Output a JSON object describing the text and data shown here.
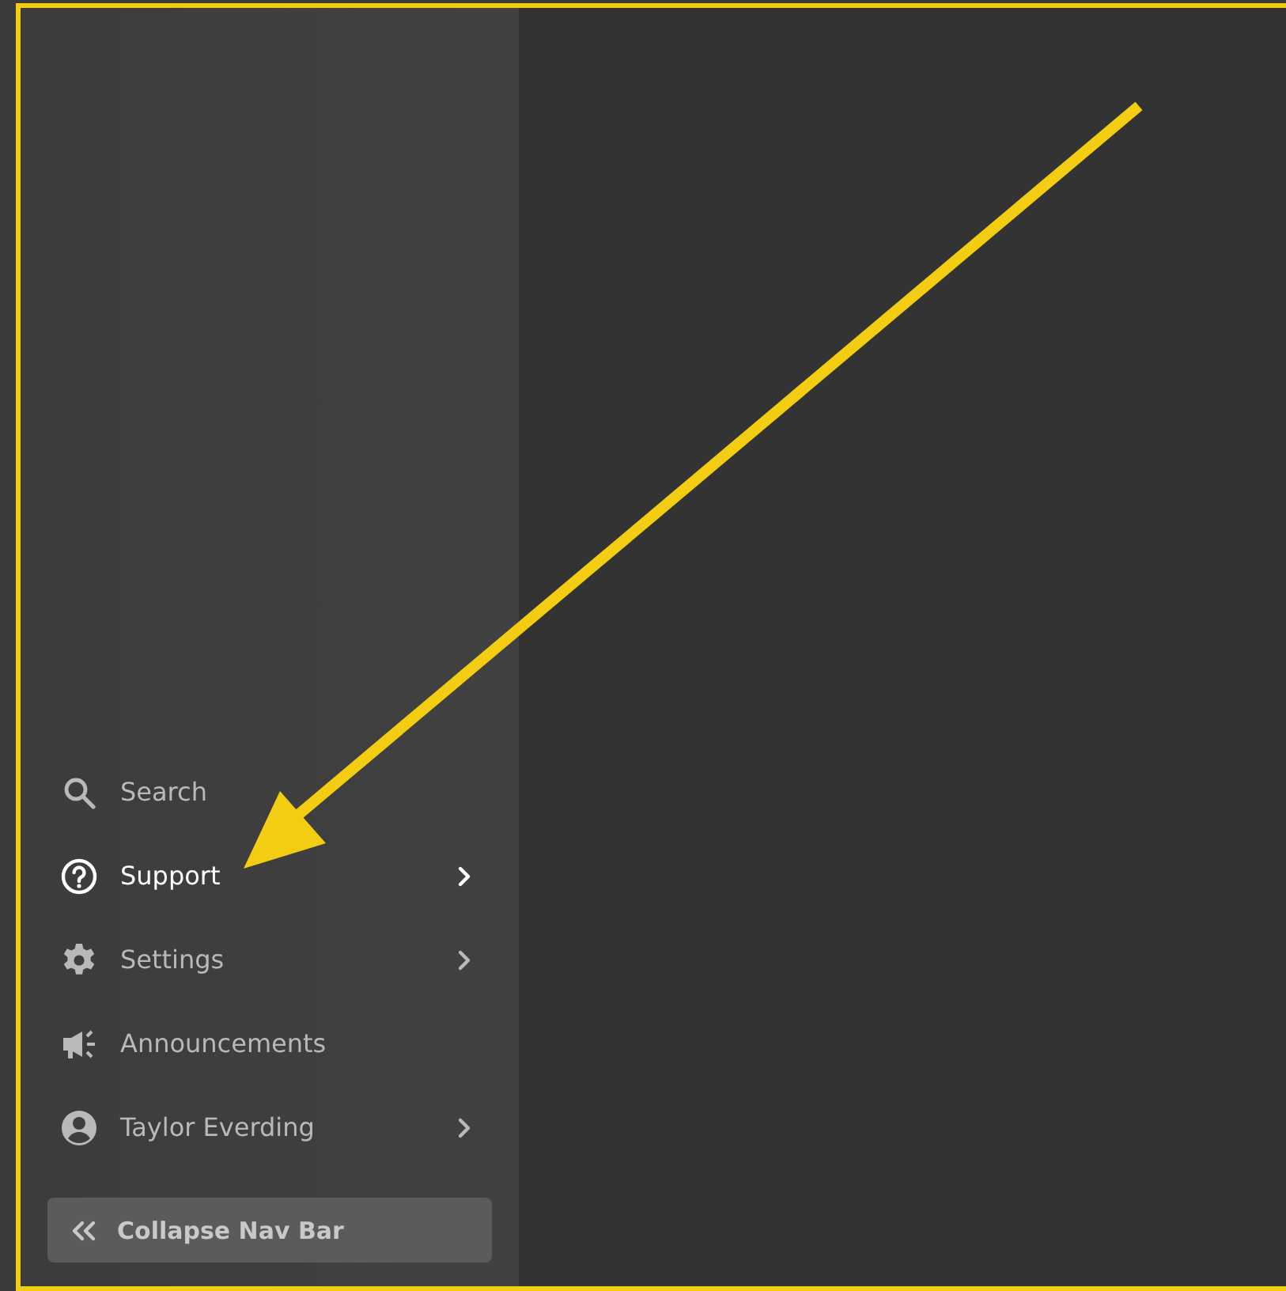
{
  "sidebar": {
    "items": [
      {
        "label": "Search",
        "selected": false,
        "has_submenu": false
      },
      {
        "label": "Support",
        "selected": true,
        "has_submenu": true
      },
      {
        "label": "Settings",
        "selected": false,
        "has_submenu": true
      },
      {
        "label": "Announcements",
        "selected": false,
        "has_submenu": false
      },
      {
        "label": "Taylor Everding",
        "selected": false,
        "has_submenu": true
      }
    ],
    "collapse_button": {
      "label": "Collapse Nav Bar"
    }
  }
}
